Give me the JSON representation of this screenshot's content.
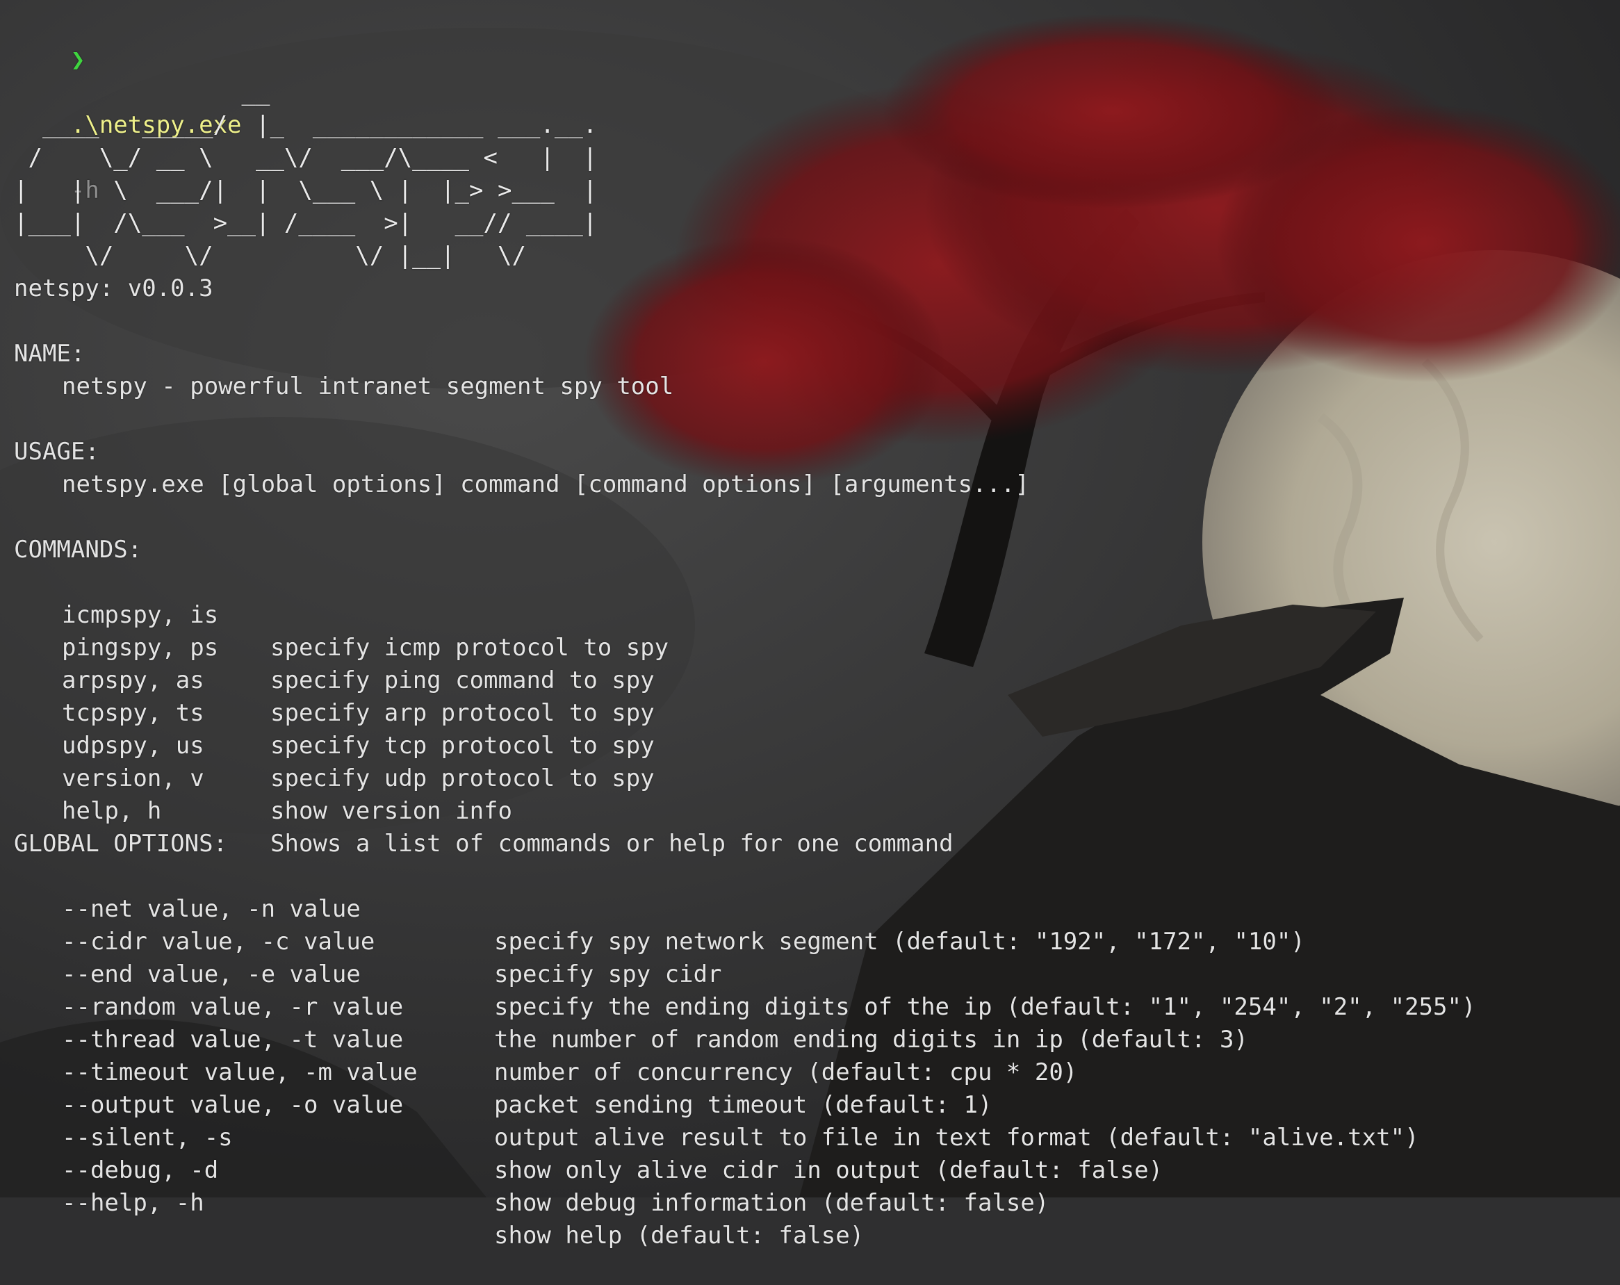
{
  "prompt": {
    "symbol": "❯",
    "command": ".\\netspy.exe",
    "argument": "-h"
  },
  "banner": [
    "                __",
    "  ____   _____/  |_  ____________ ___.__.",
    " /    \\_/ __ \\   __\\/  ___/\\____ <   |  |",
    "|   |  \\  ___/|  |  \\___ \\ |  |_> >___  |",
    "|___|  /\\___  >__| /____  >|   __// ____|",
    "     \\/     \\/          \\/ |__|   \\/"
  ],
  "version_line": "netspy: v0.0.3",
  "name_section": {
    "heading": "NAME:",
    "text": "netspy - powerful intranet segment spy tool"
  },
  "usage_section": {
    "heading": "USAGE:",
    "text": "netspy.exe [global options] command [command options] [arguments...]"
  },
  "commands_section": {
    "heading": "COMMANDS:",
    "items": [
      {
        "name": "icmpspy, is",
        "desc": "specify icmp protocol to spy"
      },
      {
        "name": "pingspy, ps",
        "desc": "specify ping command to spy"
      },
      {
        "name": "arpspy, as",
        "desc": "specify arp protocol to spy"
      },
      {
        "name": "tcpspy, ts",
        "desc": "specify tcp protocol to spy"
      },
      {
        "name": "udpspy, us",
        "desc": "specify udp protocol to spy"
      },
      {
        "name": "version, v",
        "desc": "show version info"
      },
      {
        "name": "help, h",
        "desc": "Shows a list of commands or help for one command"
      }
    ]
  },
  "global_options_section": {
    "heading": "GLOBAL OPTIONS:",
    "items": [
      {
        "flag": "--net value, -n value",
        "desc": "specify spy network segment (default: \"192\", \"172\", \"10\")"
      },
      {
        "flag": "--cidr value, -c value",
        "desc": "specify spy cidr"
      },
      {
        "flag": "--end value, -e value",
        "desc": "specify the ending digits of the ip (default: \"1\", \"254\", \"2\", \"255\")"
      },
      {
        "flag": "--random value, -r value",
        "desc": "the number of random ending digits in ip (default: 3)"
      },
      {
        "flag": "--thread value, -t value",
        "desc": "number of concurrency (default: cpu * 20)"
      },
      {
        "flag": "--timeout value, -m value",
        "desc": "packet sending timeout (default: 1)"
      },
      {
        "flag": "--output value, -o value",
        "desc": "output alive result to file in text format (default: \"alive.txt\")"
      },
      {
        "flag": "--silent, -s",
        "desc": "show only alive cidr in output (default: false)"
      },
      {
        "flag": "--debug, -d",
        "desc": "show debug information (default: false)"
      },
      {
        "flag": "--help, -h",
        "desc": "show help (default: false)"
      }
    ]
  },
  "colors": {
    "prompt_arrow": "#3fd43f",
    "command": "#eef08a",
    "argument": "#8e8e8e",
    "text": "#e4e4e4",
    "tree_foliage": "#7a1216",
    "moon": "#bdb7a6"
  }
}
